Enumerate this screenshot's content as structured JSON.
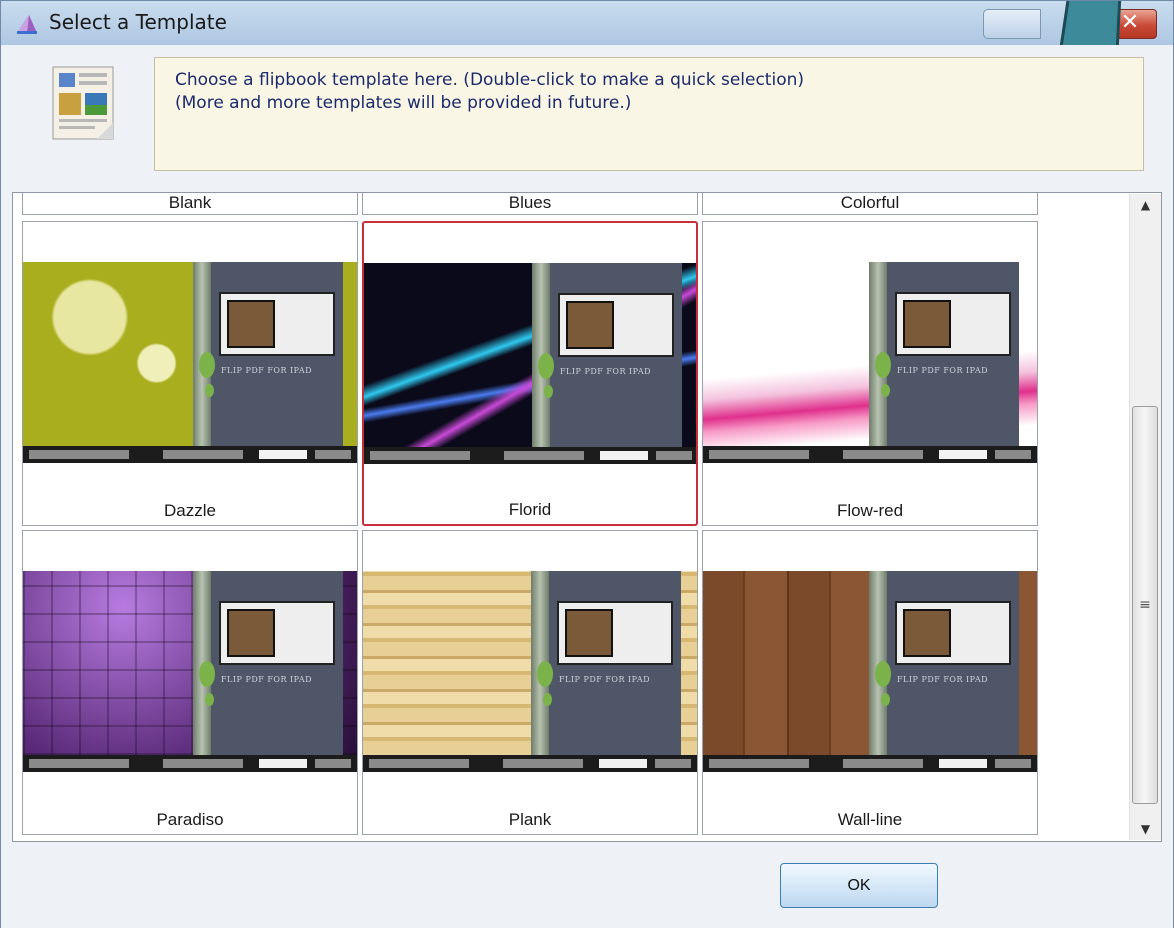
{
  "window": {
    "title": "Select a Template",
    "close_glyph": "✕",
    "icons": {
      "title": "template-icon",
      "header": "flipbook-document-icon",
      "minimize": "minimize-icon",
      "close": "close-icon"
    }
  },
  "info": {
    "line1": "Choose a flipbook template here. (Double-click to make a quick selection)",
    "line2": "(More and more templates will be provided in future.)"
  },
  "templates": {
    "top_row": [
      "Blank",
      "Blues",
      "Colorful"
    ],
    "items": [
      {
        "name": "Dazzle",
        "selected": false,
        "theme": "yellow-green damask"
      },
      {
        "name": "Florid",
        "selected": true,
        "theme": "dark with neon streaks"
      },
      {
        "name": "Flow-red",
        "selected": false,
        "theme": "white with pink waves"
      },
      {
        "name": "Paradiso",
        "selected": false,
        "theme": "purple tiles"
      },
      {
        "name": "Plank",
        "selected": false,
        "theme": "light wood"
      },
      {
        "name": "Wall-line",
        "selected": false,
        "theme": "dark wood"
      }
    ],
    "selected_name": "Florid",
    "book_title": "FLIP PDF FOR IPAD"
  },
  "scrollbar": {
    "up_glyph": "▲",
    "down_glyph": "▼",
    "grip_glyph": "≡"
  },
  "footer": {
    "ok_label": "OK"
  },
  "colors": {
    "selection_border": "#c7303a",
    "arrow": "#3d8a9a",
    "info_bg": "#faf6e6"
  }
}
